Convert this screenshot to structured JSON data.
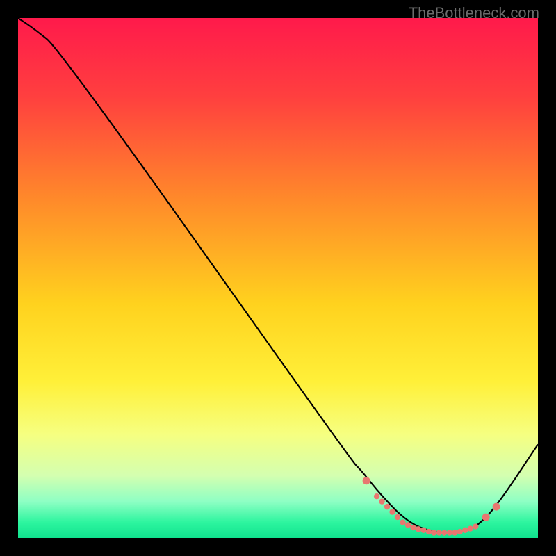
{
  "watermark": "TheBottleneck.com",
  "chart_data": {
    "type": "line",
    "title": "",
    "xlabel": "",
    "ylabel": "",
    "xlim": [
      0,
      100
    ],
    "ylim": [
      0,
      100
    ],
    "series": [
      {
        "name": "bottleneck-curve",
        "x": [
          0,
          3,
          8,
          64,
          66,
          70,
          75,
          80,
          85,
          88,
          92,
          100
        ],
        "values": [
          100,
          98,
          94,
          15,
          13,
          8,
          3,
          1,
          1,
          2,
          6,
          18
        ]
      }
    ],
    "highlight_points": {
      "name": "optimal-range-dots",
      "color": "#e87770",
      "x": [
        67,
        69,
        70,
        71,
        72,
        73,
        74,
        75,
        76,
        77,
        78,
        79,
        80,
        81,
        82,
        83,
        84,
        85,
        86,
        87,
        88,
        90,
        92
      ],
      "values": [
        11,
        8,
        7,
        6,
        5,
        4,
        3,
        2.5,
        2,
        1.7,
        1.5,
        1.2,
        1,
        1,
        1,
        1,
        1,
        1.2,
        1.5,
        1.8,
        2.2,
        4,
        6
      ]
    },
    "background_gradient": {
      "stops": [
        {
          "pos": 0.0,
          "color": "#ff1a4b"
        },
        {
          "pos": 0.15,
          "color": "#ff3f3f"
        },
        {
          "pos": 0.35,
          "color": "#ff8a2a"
        },
        {
          "pos": 0.55,
          "color": "#ffd21e"
        },
        {
          "pos": 0.7,
          "color": "#fff039"
        },
        {
          "pos": 0.8,
          "color": "#f6ff80"
        },
        {
          "pos": 0.88,
          "color": "#d4ffb0"
        },
        {
          "pos": 0.93,
          "color": "#8effc4"
        },
        {
          "pos": 0.97,
          "color": "#2df59f"
        },
        {
          "pos": 1.0,
          "color": "#10e28e"
        }
      ]
    }
  }
}
